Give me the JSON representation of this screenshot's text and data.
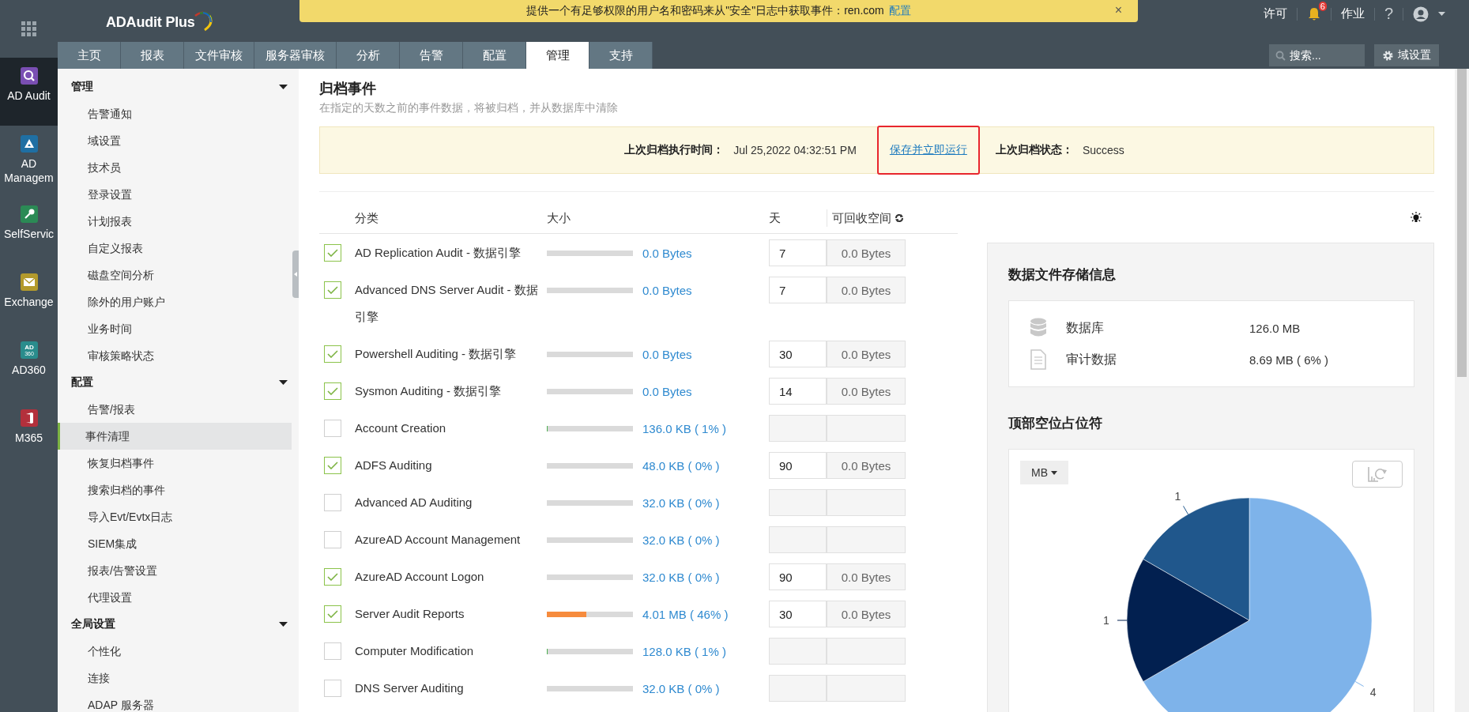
{
  "header": {
    "logo": "ADAudit Plus",
    "banner": {
      "text": "提供一个有足够权限的用户名和密码来从\"安全\"日志中获取事件：ren.com",
      "link": "配置",
      "close": "×"
    },
    "license": "许可",
    "notifications": "6",
    "jobs": "作业",
    "help": "?"
  },
  "tabs": [
    {
      "label": "主页",
      "selected": false
    },
    {
      "label": "报表",
      "selected": false
    },
    {
      "label": "文件审核",
      "selected": false
    },
    {
      "label": "服务器审核",
      "selected": false
    },
    {
      "label": "分析",
      "selected": false
    },
    {
      "label": "告警",
      "selected": false
    },
    {
      "label": "配置",
      "selected": false
    },
    {
      "label": "管理",
      "selected": true
    },
    {
      "label": "支持",
      "selected": false
    }
  ],
  "search": {
    "placeholder": "搜索..."
  },
  "domain_settings": "域设置",
  "products": [
    {
      "label": "AD Audit",
      "kind": "audit",
      "color": "#7a4fb3",
      "selected": true
    },
    {
      "label": "AD Managem",
      "kind": "management",
      "color": "#1f6fa3",
      "selected": false
    },
    {
      "label": "SelfServic",
      "kind": "selfservice",
      "color": "#2b8a55",
      "selected": false
    },
    {
      "label": "Exchange",
      "kind": "exchange",
      "color": "#b39a2c",
      "selected": false
    },
    {
      "label": "AD360",
      "kind": "ad360",
      "color": "#2a8c8c",
      "selected": false,
      "icon_lines": [
        "AD",
        "360"
      ]
    },
    {
      "label": "M365",
      "kind": "m365",
      "color": "#b3303c",
      "selected": false
    }
  ],
  "nav": [
    {
      "title": "管理",
      "expanded": true,
      "items": [
        {
          "label": "告警通知",
          "selected": false
        },
        {
          "label": "域设置",
          "selected": false
        },
        {
          "label": "技术员",
          "selected": false
        },
        {
          "label": "登录设置",
          "selected": false
        },
        {
          "label": "计划报表",
          "selected": false
        },
        {
          "label": "自定义报表",
          "selected": false
        },
        {
          "label": "磁盘空间分析",
          "selected": false
        },
        {
          "label": "除外的用户账户",
          "selected": false
        },
        {
          "label": "业务时间",
          "selected": false
        },
        {
          "label": "审核策略状态",
          "selected": false
        }
      ]
    },
    {
      "title": "配置",
      "expanded": true,
      "items": [
        {
          "label": "告警/报表",
          "selected": false
        },
        {
          "label": "事件清理",
          "selected": true
        },
        {
          "label": "恢复归档事件",
          "selected": false
        },
        {
          "label": "搜索归档的事件",
          "selected": false
        },
        {
          "label": "导入Evt/Evtx日志",
          "selected": false
        },
        {
          "label": "SIEM集成",
          "selected": false
        },
        {
          "label": "报表/告警设置",
          "selected": false
        },
        {
          "label": "代理设置",
          "selected": false
        }
      ]
    },
    {
      "title": "全局设置",
      "expanded": true,
      "items": [
        {
          "label": "个性化",
          "selected": false
        },
        {
          "label": "连接",
          "selected": false
        },
        {
          "label": "ADAP 服务器",
          "selected": false
        }
      ]
    }
  ],
  "page": {
    "title": "归档事件",
    "subtitle": "在指定的天数之前的事件数据，将被归档，并从数据库中清除"
  },
  "archive_bar": {
    "last_run_label": "上次归档执行时间：",
    "last_run": "Jul 25,2022 04:32:51 PM",
    "action": "保存并立即运行",
    "status_label": "上次归档状态：",
    "status": "Success"
  },
  "table": {
    "columns": [
      "分类",
      "大小",
      "天",
      "可回收空间"
    ],
    "rows": [
      {
        "checked": true,
        "name": "AD Replication Audit - 数据引擎",
        "level": 0,
        "size": "0.0 Bytes",
        "days": "7",
        "reclaim": "0.0 Bytes"
      },
      {
        "checked": true,
        "name": "Advanced DNS Server Audit - 数据引擎",
        "level": 0,
        "size": "0.0 Bytes",
        "days": "7",
        "reclaim": "0.0 Bytes"
      },
      {
        "checked": true,
        "name": "Powershell Auditing - 数据引擎",
        "level": 0,
        "size": "0.0 Bytes",
        "days": "30",
        "reclaim": "0.0 Bytes"
      },
      {
        "checked": true,
        "name": "Sysmon Auditing - 数据引擎",
        "level": 0,
        "size": "0.0 Bytes",
        "days": "14",
        "reclaim": "0.0 Bytes"
      },
      {
        "checked": false,
        "name": "Account Creation",
        "level": 0.01,
        "size": "136.0 KB ( 1% )"
      },
      {
        "checked": true,
        "name": "ADFS Auditing",
        "level": 0,
        "size": "48.0 KB ( 0% )",
        "days": "90",
        "reclaim": "0.0 Bytes"
      },
      {
        "checked": false,
        "name": "Advanced AD Auditing",
        "level": 0,
        "size": "32.0 KB ( 0% )"
      },
      {
        "checked": false,
        "name": "AzureAD Account Management",
        "level": 0,
        "size": "32.0 KB ( 0% )"
      },
      {
        "checked": true,
        "name": "AzureAD Account Logon",
        "level": 0,
        "size": "32.0 KB ( 0% )",
        "days": "90",
        "reclaim": "0.0 Bytes"
      },
      {
        "checked": true,
        "name": "Server Audit Reports",
        "level": 0.46,
        "size": "4.01 MB ( 46% )",
        "days": "30",
        "reclaim": "0.0 Bytes"
      },
      {
        "checked": false,
        "name": "Computer Modification",
        "level": 0.01,
        "size": "128.0 KB ( 1% )"
      },
      {
        "checked": false,
        "name": "DNS Server Auditing",
        "level": 0,
        "size": "32.0 KB ( 0% )"
      }
    ]
  },
  "storage": {
    "title": "数据文件存储信息",
    "rows": [
      {
        "kind": "database",
        "label": "数据库",
        "value": "126.0 MB"
      },
      {
        "kind": "file",
        "label": "审计数据",
        "value": "8.69 MB ( 6% )"
      }
    ]
  },
  "top_chart": {
    "title": "顶部空位占位符",
    "unit": "MB",
    "chart_data": {
      "type": "pie",
      "values": [
        4,
        1,
        1
      ],
      "data_labels": true
    }
  }
}
